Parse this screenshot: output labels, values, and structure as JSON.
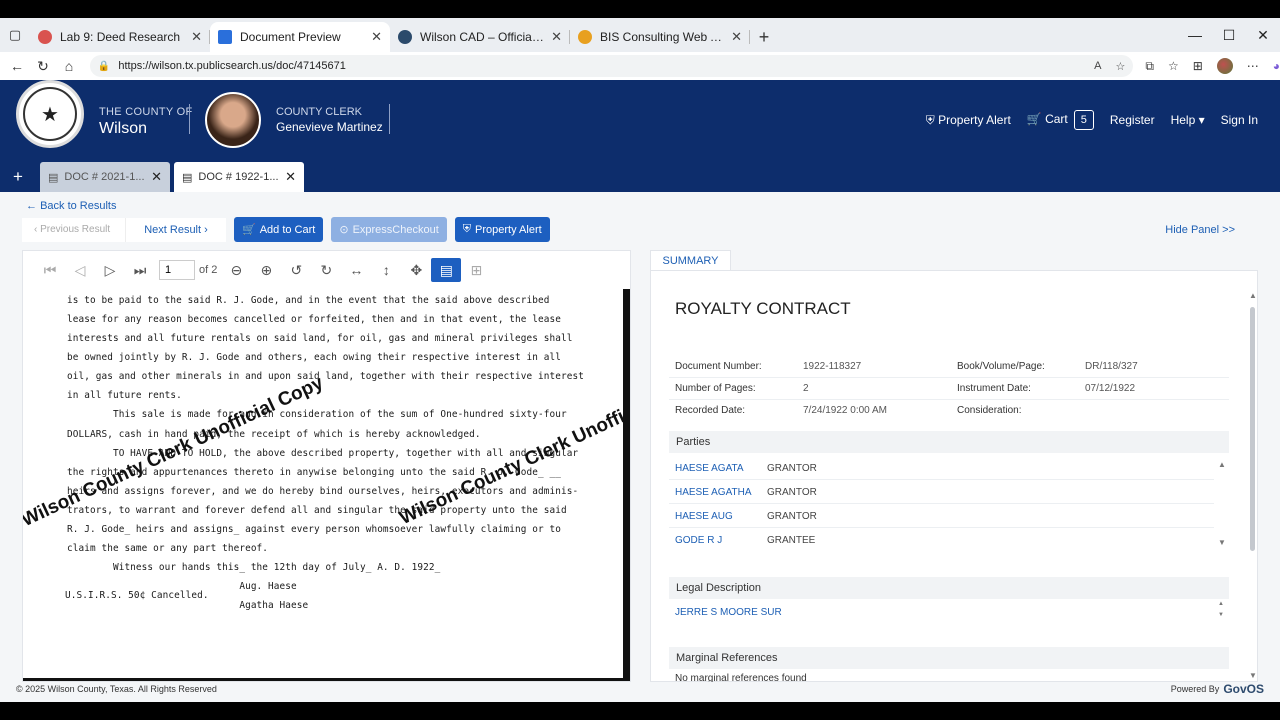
{
  "browser": {
    "tabs": [
      {
        "title": "Lab 9: Deed Research",
        "color": "#d9534f"
      },
      {
        "title": "Document Preview",
        "color": "#2a6fdb"
      },
      {
        "title": "Wilson CAD – Official Site",
        "color": "#2b4a6b"
      },
      {
        "title": "BIS Consulting Web App",
        "color": "#e8a020"
      }
    ],
    "url": "https://wilson.tx.publicsearch.us/doc/47145671"
  },
  "header": {
    "county_label": "THE COUNTY OF",
    "county_name": "Wilson",
    "clerk_label": "COUNTY CLERK",
    "clerk_name": "Genevieve Martinez",
    "property_alert": "Property Alert",
    "cart": "Cart",
    "cart_count": "5",
    "register": "Register",
    "help": "Help",
    "sign_in": "Sign In"
  },
  "doc_tabs": [
    {
      "label": "DOC # 2021-1..."
    },
    {
      "label": "DOC # 1922-1..."
    }
  ],
  "toolbar": {
    "back": "Back to Results",
    "prev": "Previous Result",
    "next": "Next Result",
    "add_to_cart": "Add to Cart",
    "express_checkout": "ExpressCheckout",
    "property_alert": "Property Alert",
    "hide_panel": "Hide Panel >>"
  },
  "viewer": {
    "page": "1",
    "of_pages": "of 2",
    "lines": [
      "is to be paid to the said R. J. Gode, and in the event that the said above described",
      "lease for any reason becomes cancelled or forfeited, then and in that event, the lease",
      "interests and all future rentals on said land, for oil, gas and mineral privileges shall",
      "be owned jointly by R. J. Gode and others, each owing their respective interest in all",
      "oil, gas and other minerals in and upon said land, together with their respective interest",
      "in all future rents.",
      "        This sale is made for and in consideration of the sum of One-hundred sixty-four",
      "DOLLARS, cash in hand paid, the receipt of which is hereby acknowledged.",
      "        TO HAVE AND TO HOLD, the above described property, together with all and singular",
      "the rights and appurtenances thereto in anywise belonging unto the said R. J. Gode_ __",
      "heirs and assigns forever, and we do hereby bind ourselves, heirs, executors and adminis-",
      "trators, to warrant and forever defend all and singular the said property unto the said",
      "R. J. Gode_ heirs and assigns_ against every person whomsoever lawfully claiming or to",
      "claim the same or any part thereof.",
      "        Witness our hands this_ the 12th day of July_ A. D. 1922_",
      "                              Aug. Haese",
      "U.S.I.R.S. 50¢ Cancelled.",
      "                              Agatha Haese"
    ],
    "watermark": "Wilson County Clerk Unofficial Copy",
    "watermark2": "Wilson County Clerk Unofficia"
  },
  "summary": {
    "tab": "SUMMARY",
    "title": "ROYALTY CONTRACT",
    "fields": {
      "doc_number_label": "Document Number:",
      "doc_number": "1922-118327",
      "pages_label": "Number of Pages:",
      "pages": "2",
      "recorded_label": "Recorded Date:",
      "recorded": "7/24/1922 0:00 AM",
      "book_label": "Book/Volume/Page:",
      "book": "DR/118/327",
      "instrument_label": "Instrument Date:",
      "instrument": "07/12/1922",
      "consideration_label": "Consideration:"
    },
    "parties_header": "Parties",
    "parties": [
      {
        "name": "HAESE AGATA",
        "role": "GRANTOR"
      },
      {
        "name": "HAESE AGATHA",
        "role": "GRANTOR"
      },
      {
        "name": "HAESE AUG",
        "role": "GRANTOR"
      },
      {
        "name": "GODE R J",
        "role": "GRANTEE"
      }
    ],
    "legal_header": "Legal Description",
    "legal": "JERRE S MOORE SUR",
    "marginal_header": "Marginal References",
    "marginal": "No marginal references found"
  },
  "footer": {
    "copyright": "© 2025 Wilson County, Texas. All Rights Reserved",
    "powered": "Powered By",
    "brand": "GovOS"
  }
}
